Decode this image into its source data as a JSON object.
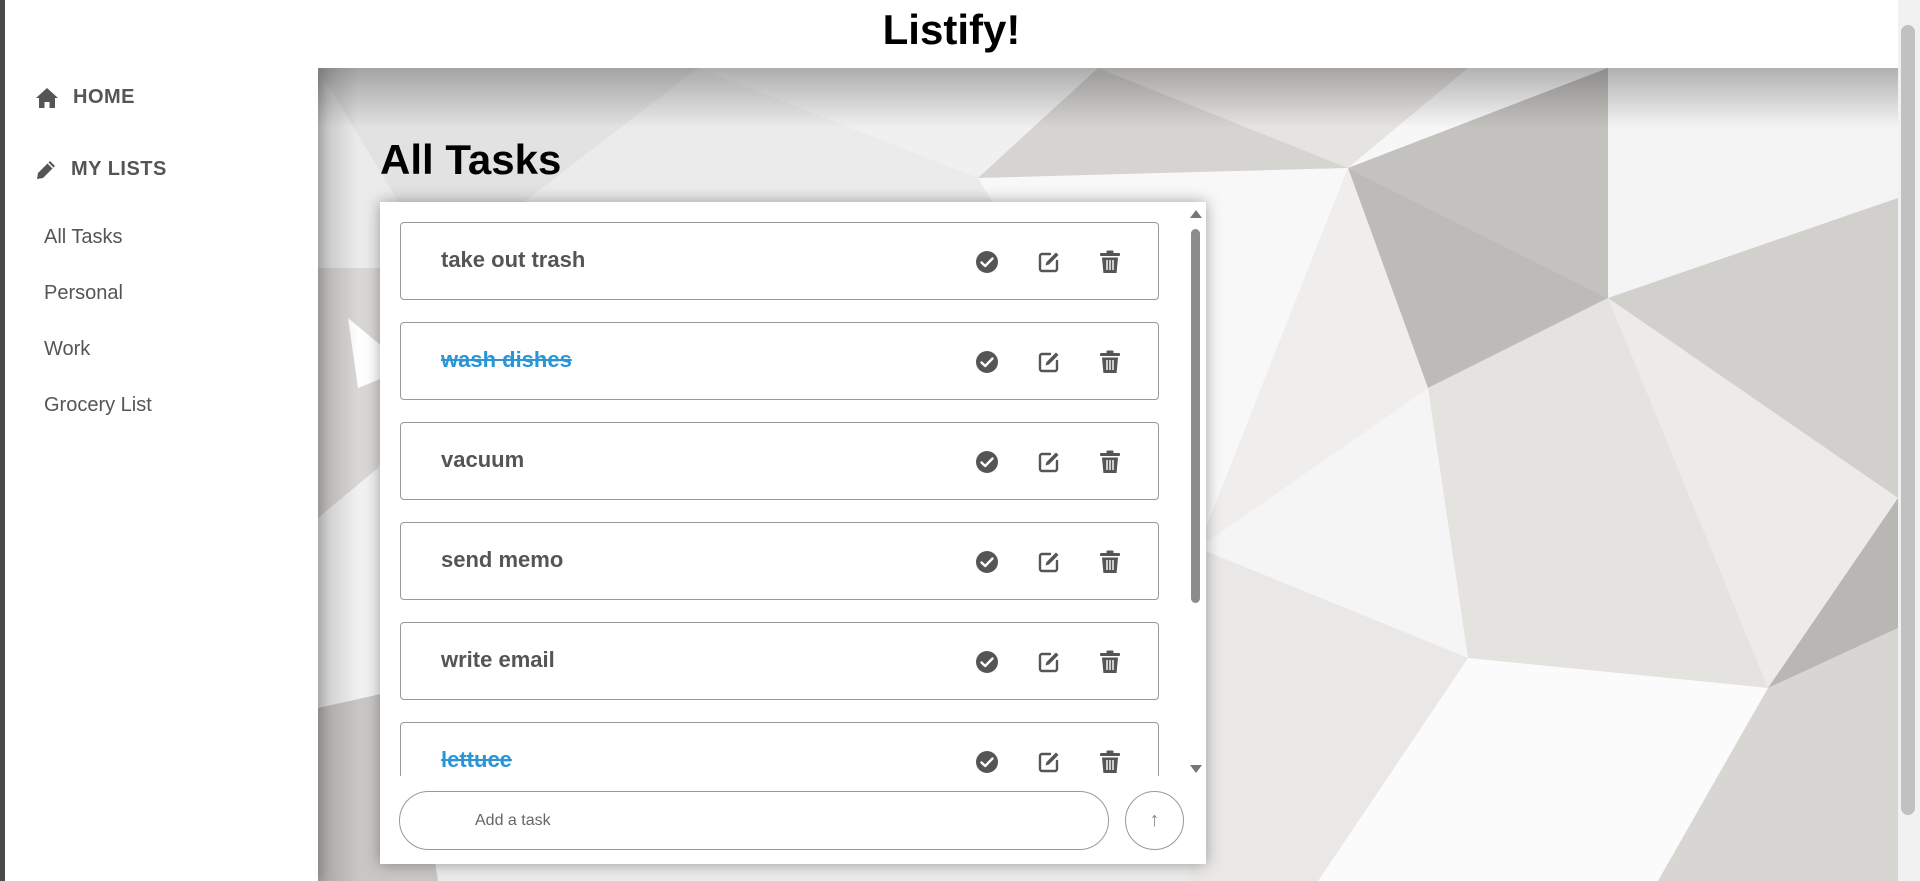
{
  "app": {
    "title": "Listify!"
  },
  "sidebar": {
    "home_label": "HOME",
    "my_lists_label": "MY LISTS",
    "lists": [
      "All Tasks",
      "Personal",
      "Work",
      "Grocery List"
    ]
  },
  "main": {
    "heading": "All Tasks"
  },
  "tasks": [
    {
      "text": "take out trash",
      "done": false
    },
    {
      "text": "wash dishes",
      "done": true
    },
    {
      "text": "vacuum",
      "done": false
    },
    {
      "text": "send memo",
      "done": false
    },
    {
      "text": "write email",
      "done": false
    },
    {
      "text": "lettuce",
      "done": true
    }
  ],
  "add_task": {
    "placeholder": "Add a task",
    "button_symbol": "↑"
  },
  "colors": {
    "done_text": "#2a96d8",
    "task_text": "#555555",
    "icon": "#555555"
  },
  "icons": {
    "home": "home-icon",
    "my_lists": "pencil-icon",
    "check": "check-circle-icon",
    "edit": "edit-icon",
    "delete": "trash-icon"
  }
}
